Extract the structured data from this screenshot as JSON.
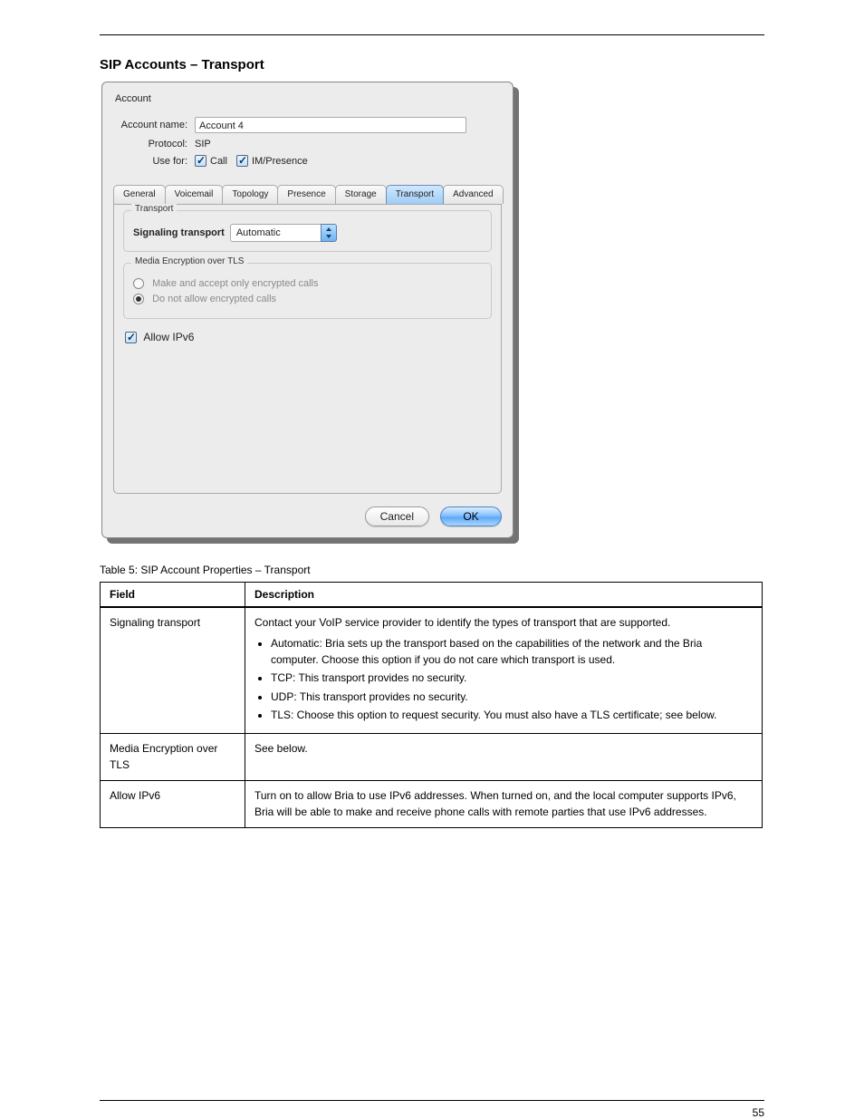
{
  "pageHeading": "SIP Accounts – Transport",
  "dialog": {
    "accountHeader": "Account",
    "accountNameLabel": "Account name:",
    "accountNameValue": "Account 4",
    "protocolLabel": "Protocol:",
    "protocolValue": "SIP",
    "useForLabel": "Use for:",
    "useForCall": "Call",
    "useForIM": "IM/Presence",
    "tabs": {
      "general": "General",
      "voicemail": "Voicemail",
      "topology": "Topology",
      "presence": "Presence",
      "storage": "Storage",
      "transport": "Transport",
      "advanced": "Advanced"
    },
    "transportGroup": {
      "legend": "Transport",
      "signalingLabel": "Signaling transport",
      "signalingValue": "Automatic"
    },
    "mediaGroup": {
      "legend": "Media Encryption over TLS",
      "opt1": "Make and accept only encrypted calls",
      "opt2": "Do not allow encrypted calls"
    },
    "allowIPv6": "Allow IPv6",
    "cancel": "Cancel",
    "ok": "OK"
  },
  "tableCaption": "Table 5: SIP Account Properties – Transport",
  "tableHeaders": {
    "field": "Field",
    "description": "Description"
  },
  "rows": {
    "signaling": {
      "name": "Signaling transport",
      "desc_intro": "Contact your VoIP service provider to identify the types of transport that are supported.",
      "bullets": [
        "Automatic: Bria sets up the transport based on the capabilities of the network and the Bria computer. Choose this option if you do not care which transport is used.",
        "TCP: This transport provides no security.",
        "UDP: This transport provides no security.",
        "TLS: Choose this option to request security. You must also have a TLS certificate; see below."
      ]
    },
    "media": {
      "name": "Media Encryption over TLS",
      "desc": "See below."
    },
    "ipv6": {
      "name": "Allow IPv6",
      "desc": "Turn on to allow Bria to use IPv6 addresses. When turned on, and the local computer supports IPv6, Bria will be able to make and receive phone calls with remote parties that use IPv6 addresses."
    }
  },
  "footer": "55"
}
